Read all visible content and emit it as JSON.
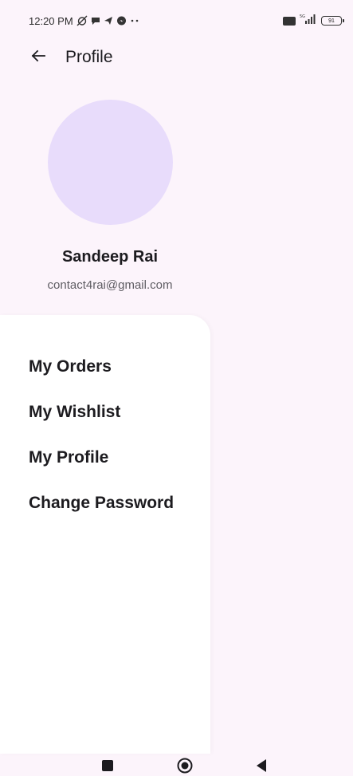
{
  "status_bar": {
    "time": "12:20 PM",
    "notification_icons": [
      "alarm-off-icon",
      "chat-icon",
      "telegram-icon",
      "messenger-icon",
      "more-dots-icon"
    ],
    "volte_icon": "volte-icon",
    "network": "5G",
    "signal_icon": "signal-icon",
    "battery_level": "91"
  },
  "app_bar": {
    "back_icon": "arrow-left-icon",
    "title": "Profile"
  },
  "profile": {
    "avatar_color": "#e8dcfb",
    "name": "Sandeep Rai",
    "email": "contact4rai@gmail.com"
  },
  "menu": {
    "items": [
      {
        "label": "My Orders"
      },
      {
        "label": "My Wishlist"
      },
      {
        "label": "My Profile"
      },
      {
        "label": "Change Password"
      }
    ]
  },
  "nav_bar": {
    "recent_icon": "square-recents-icon",
    "home_icon": "circle-home-icon",
    "back_icon": "triangle-back-icon"
  },
  "colors": {
    "background": "#fcf4fb",
    "panel": "#ffffff",
    "avatar": "#e8dcfb",
    "text": "#1c1b1f",
    "subtext": "#5f5d63"
  }
}
